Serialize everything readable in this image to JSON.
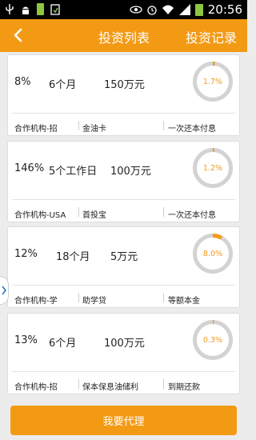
{
  "status_bar": {
    "time": "20:56",
    "icons": [
      "usb-icon",
      "android-debug-icon",
      "battery-small-icon",
      "notification-icon",
      "eye-icon",
      "alarm-icon",
      "wifi-icon",
      "signal-icon",
      "battery-icon"
    ]
  },
  "header": {
    "back_icon": "chevron-left-icon",
    "title": "投资列表",
    "action": "投资记录"
  },
  "colors": {
    "accent": "#f39a15",
    "ring_track": "#d3d3d3",
    "background": "#ececec"
  },
  "items": [
    {
      "rate": "8%",
      "term": "6个月",
      "amount": "150万元",
      "progress_label": "1.7%",
      "progress": 0.017,
      "org": "合作机构-招",
      "product": "金油卡",
      "repayment": "一次还本付息"
    },
    {
      "rate": "146%",
      "term": "5个工作日",
      "amount": "100万元",
      "progress_label": "1.2%",
      "progress": 0.012,
      "org": "合作机构-USA",
      "product": "首投宝",
      "repayment": "一次还本付息"
    },
    {
      "rate": "12%",
      "term": "18个月",
      "amount": "5万元",
      "progress_label": "8.0%",
      "progress": 0.08,
      "org": "合作机构-学",
      "product": "助学贷",
      "repayment": "等额本金"
    },
    {
      "rate": "13%",
      "term": "6个月",
      "amount": "100万元",
      "progress_label": "0.3%",
      "progress": 0.003,
      "org": "合作机构-招",
      "product": "保本保息油储利",
      "repayment": "到期还款"
    }
  ],
  "side_handle_icon": "chevron-right-icon",
  "cta": {
    "label": "我要代理"
  }
}
